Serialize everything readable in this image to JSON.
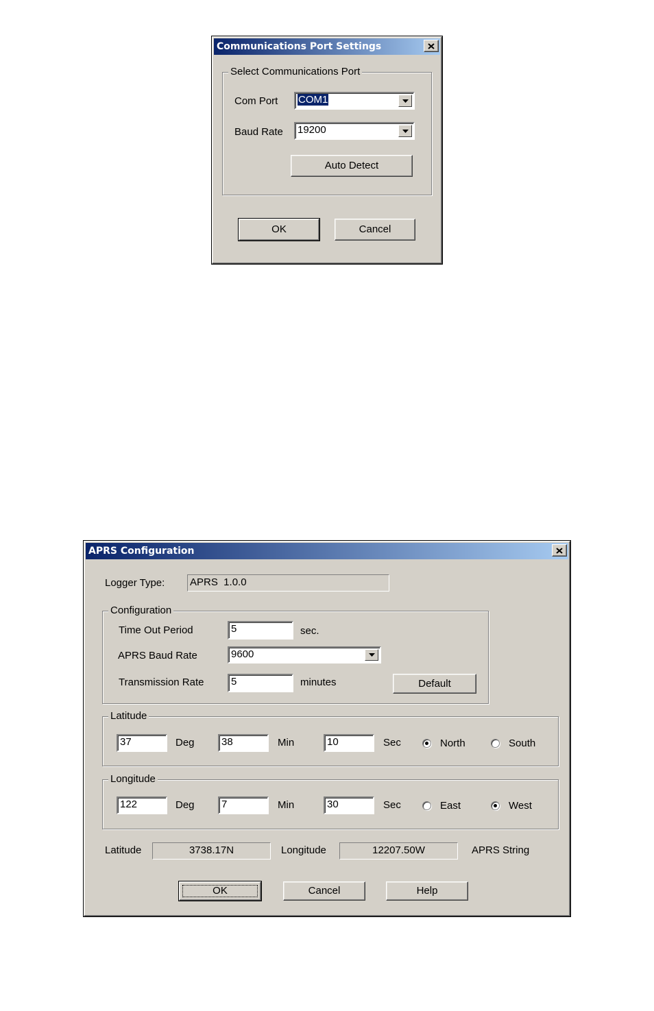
{
  "comm_dialog": {
    "title": "Communications Port Settings",
    "group_label": "Select Communications Port",
    "com_port_label": "Com Port",
    "com_port_value": "COM1",
    "baud_rate_label": "Baud Rate",
    "baud_rate_value": "19200",
    "auto_detect_label": "Auto Detect",
    "ok_label": "OK",
    "cancel_label": "Cancel"
  },
  "aprs_dialog": {
    "title": "APRS Configuration",
    "logger_type_label": "Logger Type:",
    "logger_type_value": "APRS  1.0.0",
    "configuration": {
      "group_label": "Configuration",
      "timeout_label": "Time Out Period",
      "timeout_value": "5",
      "timeout_unit": "sec.",
      "baud_label": "APRS Baud Rate",
      "baud_value": "9600",
      "tx_rate_label": "Transmission Rate",
      "tx_rate_value": "5",
      "tx_rate_unit": "minutes",
      "default_label": "Default"
    },
    "latitude": {
      "group_label": "Latitude",
      "deg_value": "37",
      "deg_label": "Deg",
      "min_value": "38",
      "min_label": "Min",
      "sec_value": "10",
      "sec_label": "Sec",
      "option1_label": "North",
      "option2_label": "South",
      "selected": "North"
    },
    "longitude": {
      "group_label": "Longitude",
      "deg_value": "122",
      "deg_label": "Deg",
      "min_value": "7",
      "min_label": "Min",
      "sec_value": "30",
      "sec_label": "Sec",
      "option1_label": "East",
      "option2_label": "West",
      "selected": "West"
    },
    "summary": {
      "latitude_label": "Latitude",
      "latitude_value": "3738.17N",
      "longitude_label": "Longitude",
      "longitude_value": "12207.50W",
      "aprs_string_label": "APRS String"
    },
    "ok_label": "OK",
    "cancel_label": "Cancel",
    "help_label": "Help"
  }
}
